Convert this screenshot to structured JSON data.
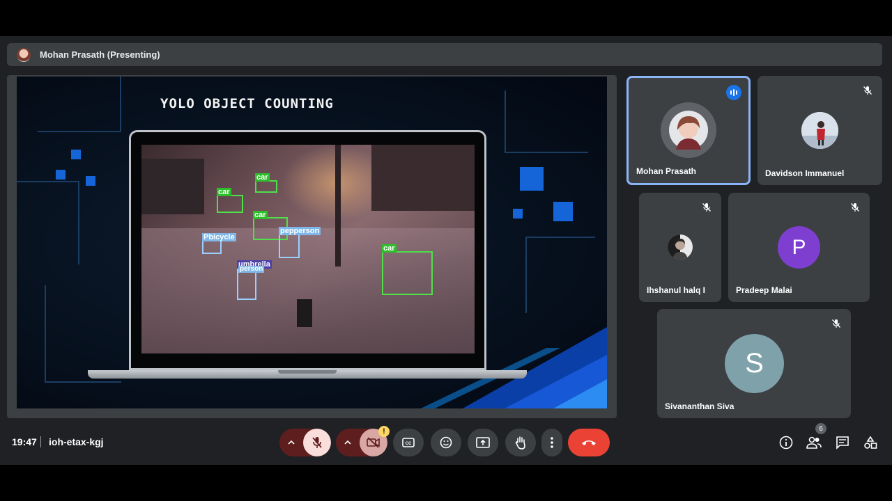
{
  "presenter_bar": {
    "label": "Mohan Prasath (Presenting)"
  },
  "slide": {
    "title": "YOLO OBJECT COUNTING",
    "detections": [
      "car",
      "car",
      "car",
      "car",
      "Pbicycle",
      "pepperson",
      "umbrella",
      "person"
    ]
  },
  "participants": [
    {
      "name": "Mohan Prasath",
      "speaking": true,
      "muted": false
    },
    {
      "name": "Davidson Immanuel",
      "muted": true
    },
    {
      "name": "Ihshanul halq I",
      "muted": true
    },
    {
      "name": "Pradeep Malai",
      "initial": "P",
      "avatar_color": "#7e3fd1",
      "muted": true
    },
    {
      "name": "Sivananthan Siva",
      "initial": "S",
      "avatar_color": "#7ea1aa",
      "muted": true
    }
  ],
  "meeting": {
    "time": "19:47",
    "code": "ioh-etax-kgj"
  },
  "controls": {
    "camera_warning": "!",
    "people_count": "6"
  },
  "icons": {
    "mic": "mic-off-icon",
    "cam": "camera-off-icon",
    "captions": "captions-icon",
    "emoji": "emoji-icon",
    "present": "present-screen-icon",
    "hand": "raise-hand-icon",
    "more": "more-options-icon",
    "end": "end-call-icon",
    "info": "info-icon",
    "people": "people-icon",
    "chat": "chat-icon",
    "activities": "activities-icon"
  },
  "colors": {
    "end_call": "#ea4335",
    "active_tile_border": "#8ab4f8",
    "speaking_badge": "#1a73e8"
  }
}
